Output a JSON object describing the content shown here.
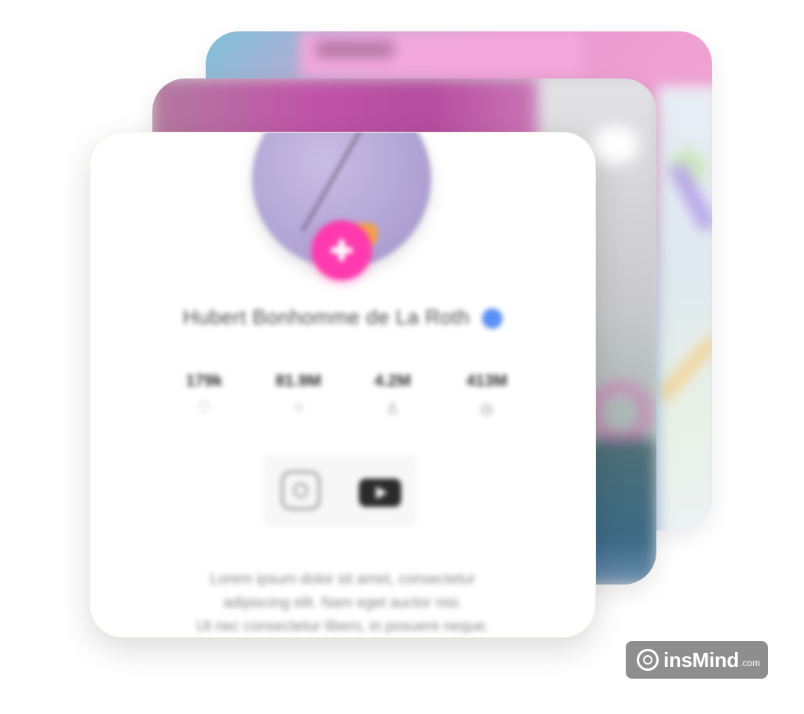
{
  "profile": {
    "name": "Hubert Bonhomme de La Roth",
    "stats": [
      {
        "value": "179k",
        "icon": "heart-icon"
      },
      {
        "value": "81.9M",
        "icon": "chat-icon"
      },
      {
        "value": "4.2M",
        "icon": "user-icon"
      },
      {
        "value": "413M",
        "icon": "eye-icon"
      }
    ],
    "social": [
      "instagram-icon",
      "youtube-icon"
    ],
    "bio": [
      "Lorem ipsum dolor sit amet, consectetur",
      "adipiscing elit. Nam eget auctor nisi.",
      "Ut nec consectetur libero, in posuere neque."
    ]
  },
  "watermark": {
    "brand": "insMind",
    "domain": ".com"
  },
  "colors": {
    "accent_pink": "#ff3aae",
    "verified_blue": "#5b8ff5"
  }
}
